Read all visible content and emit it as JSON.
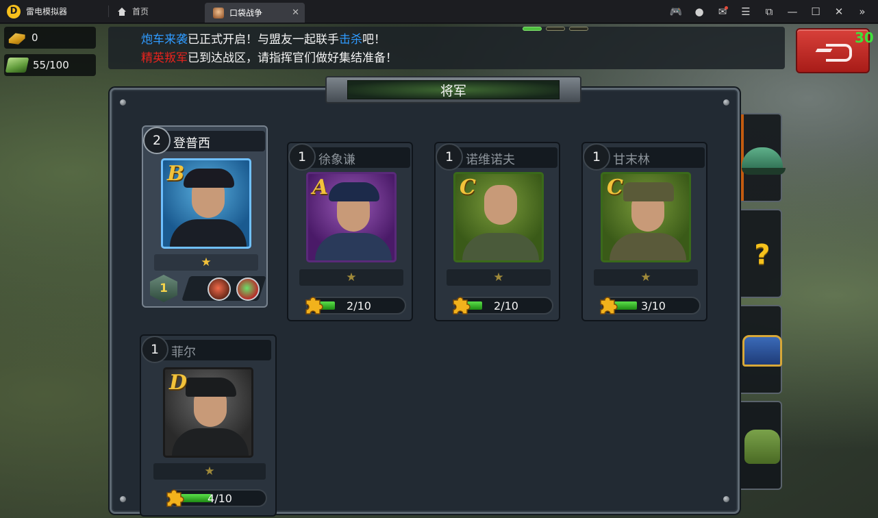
{
  "emulator": {
    "app_name": "雷电模拟器",
    "logo_glyph": "D",
    "home_tab": "首页",
    "game_tab": "口袋战争",
    "tab_close": "✕",
    "controls": [
      "🎮",
      "●",
      "✉",
      "☰",
      "⧉",
      "—",
      "☐",
      "✕",
      "»"
    ]
  },
  "resources": {
    "gold": "0",
    "cash": "55/100"
  },
  "news": {
    "line1": {
      "hl1": "炮车来袭",
      "mid": "已正式开启！与盟友一起联手",
      "hl2": "击杀",
      "end": "吧！"
    },
    "line2": {
      "hl": "精英叛军",
      "rest": "已到达战区，请指挥官们做好集结准备！"
    }
  },
  "countdown": "30",
  "panel": {
    "title": "将军"
  },
  "generals": [
    {
      "level": "2",
      "name": "登普西",
      "grade": "B",
      "stars": "★",
      "rank": "1",
      "owned": true
    },
    {
      "level": "1",
      "name": "徐象谦",
      "grade": "A",
      "stars": "★",
      "fragments": "2/10",
      "progress": 0.2,
      "owned": false
    },
    {
      "level": "1",
      "name": "诺维诺夫",
      "grade": "C",
      "stars": "★",
      "fragments": "2/10",
      "progress": 0.2,
      "owned": false
    },
    {
      "level": "1",
      "name": "甘末林",
      "grade": "C",
      "stars": "★",
      "fragments": "3/10",
      "progress": 0.3,
      "owned": false
    },
    {
      "level": "1",
      "name": "菲尔",
      "grade": "D",
      "stars": "★",
      "fragments": "4/10",
      "progress": 0.4,
      "owned": false
    }
  ],
  "colors": {
    "news_highlight_blue": "#2f9bff",
    "news_highlight_red": "#e8231d",
    "countdown_green": "#3fe03a",
    "fragment_bar_green": "#3fbf2f",
    "star_gold": "#f2c13a"
  }
}
